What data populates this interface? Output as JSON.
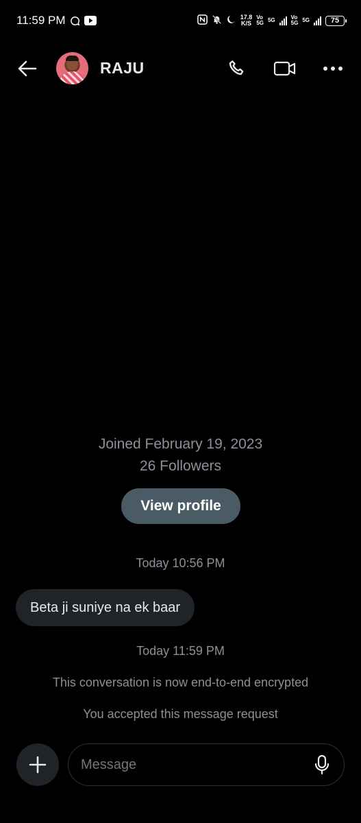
{
  "status_bar": {
    "time": "11:59 PM",
    "net_speed_value": "17.8",
    "net_speed_unit": "K/S",
    "sim1_top": "Vo",
    "sim1_bottom": "5G",
    "sim1_net": "5G",
    "sim2_top": "Vo",
    "sim2_bottom": "5G",
    "sim2_net": "5G",
    "battery": "75",
    "icons": [
      "chat-bubble-icon",
      "youtube-icon",
      "nfc-icon",
      "bell-off-icon",
      "moon-icon"
    ]
  },
  "header": {
    "contact_name": "RAJU"
  },
  "profile": {
    "joined": "Joined February 19, 2023",
    "followers": "26 Followers",
    "view_profile_label": "View profile"
  },
  "messages": [
    {
      "timestamp": "Today 10:56 PM",
      "text": "Beta ji suniye na ek baar",
      "direction": "incoming"
    }
  ],
  "system": {
    "timestamp": "Today 11:59 PM",
    "encrypted_notice": "This conversation is now end-to-end encrypted",
    "accepted_notice": "You accepted this message request"
  },
  "composer": {
    "placeholder": "Message"
  },
  "colors": {
    "background": "#000000",
    "button_bg": "#4a5b66",
    "bubble_bg": "#202327",
    "muted_text": "#8b9198"
  }
}
